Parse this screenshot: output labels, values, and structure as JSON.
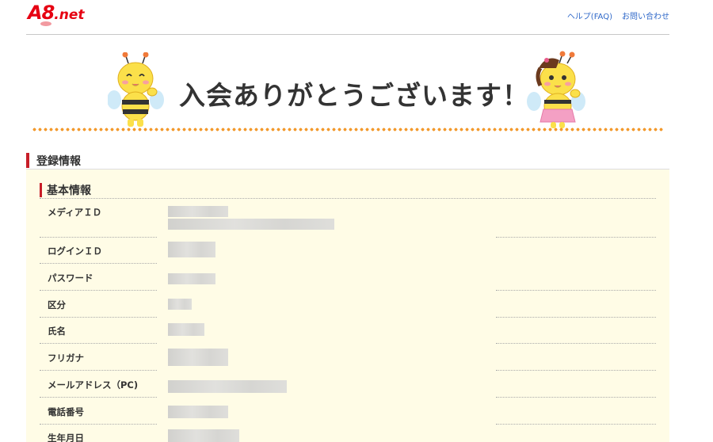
{
  "header": {
    "logo_text": "A8",
    "logo_suffix": ".net",
    "links": [
      "ヘルプ(FAQ)",
      "お問い合わせ"
    ]
  },
  "banner": {
    "title": "入会ありがとうございます！"
  },
  "section": {
    "title": "登録情報",
    "subsection_title": "基本情報"
  },
  "rows": [
    {
      "label": "メディアＩＤ",
      "value": ""
    },
    {
      "label": "ログインＩＤ",
      "value": ""
    },
    {
      "label": "パスワード",
      "value": ""
    },
    {
      "label": "区分",
      "value": ""
    },
    {
      "label": "氏名",
      "value": ""
    },
    {
      "label": "フリガナ",
      "value": ""
    },
    {
      "label": "メールアドレス（PC)",
      "value": ""
    },
    {
      "label": "電話番号",
      "value": ""
    },
    {
      "label": "生年月日",
      "value": ""
    }
  ],
  "colors": {
    "brand_red": "#e60012",
    "accent_bar": "#c71e28",
    "link_blue": "#3069c9",
    "dotted_orange": "#f39a2e",
    "info_bg": "#fffce6"
  }
}
